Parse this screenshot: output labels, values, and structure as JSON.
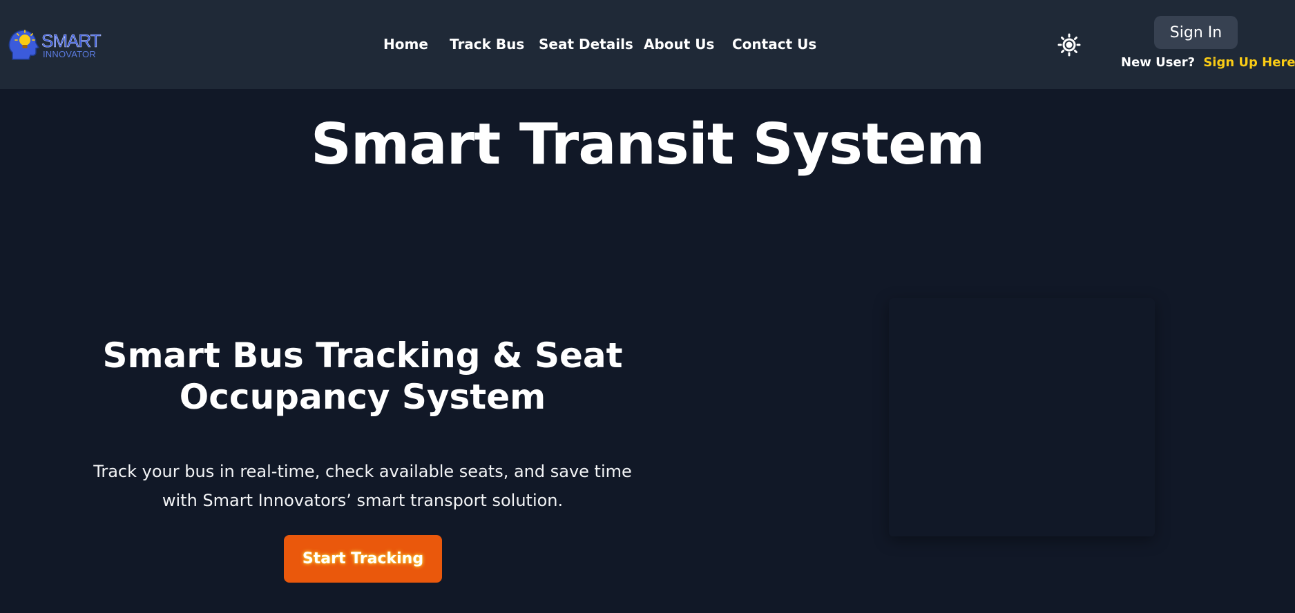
{
  "brand": {
    "logo_line_1": "SMART",
    "logo_line_2": "INNOVATOR",
    "logo_color": "#3b5bdb",
    "bulb_color": "#facc15"
  },
  "nav": {
    "items": [
      {
        "label": "Home"
      },
      {
        "label": "Track Bus"
      },
      {
        "label": "Seat Details"
      },
      {
        "label": "About Us"
      },
      {
        "label": "Contact Us"
      }
    ]
  },
  "header": {
    "theme_toggle_icon": "sun-icon",
    "signin_label": "Sign In",
    "signup_prompt": "New User?",
    "signup_link": "Sign Up Here",
    "signup_link_color": "#facc15"
  },
  "hero": {
    "title": "Smart Transit System",
    "subtitle": "Smart Bus Tracking & Seat Occupancy System",
    "description": "Track your bus in real-time, check available seats, and save time with Smart Innovators’ smart transport solution.",
    "cta_label": "Start Tracking",
    "cta_color": "#ea580c"
  },
  "colors": {
    "background": "#111827",
    "navbar": "#1f2937",
    "button_gray": "#374151"
  }
}
